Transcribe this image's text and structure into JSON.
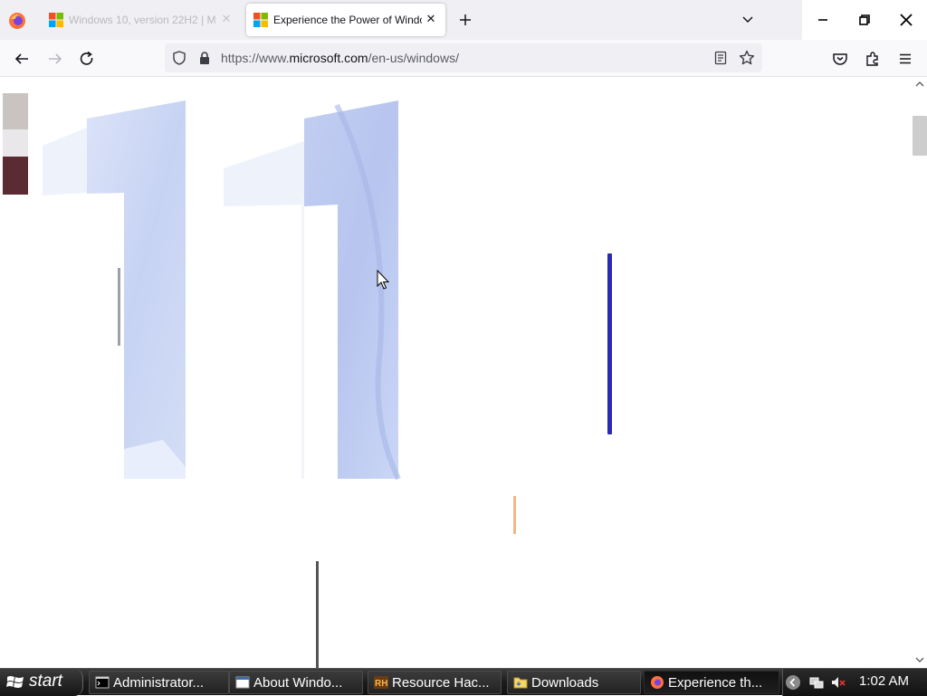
{
  "browser": {
    "tabs": [
      {
        "title": "Windows 10, version 22H2 | M",
        "active": false
      },
      {
        "title": "Experience the Power of Windo",
        "active": true
      }
    ],
    "url": {
      "prefix": "https://www.",
      "domain": "microsoft.com",
      "path": "/en-us/windows/"
    }
  },
  "page": {
    "hero_text": "11",
    "accent_colors": {
      "blue_bar": "#2a2ab8",
      "orange_bar": "#f5b48a",
      "grey_bar": "#555555",
      "hero_blue": "#c7d3f3"
    }
  },
  "taskbar": {
    "start_label": "start",
    "tasks": [
      {
        "label": "Administrator...",
        "icon": "cmd-icon"
      },
      {
        "label": "About Windo...",
        "icon": "window-icon"
      },
      {
        "label": "Resource Hac...",
        "icon": "resource-hacker-icon"
      },
      {
        "label": "Downloads",
        "icon": "folder-icon"
      },
      {
        "label": "Experience th...",
        "icon": "firefox-icon"
      }
    ],
    "clock": "1:02 AM"
  }
}
